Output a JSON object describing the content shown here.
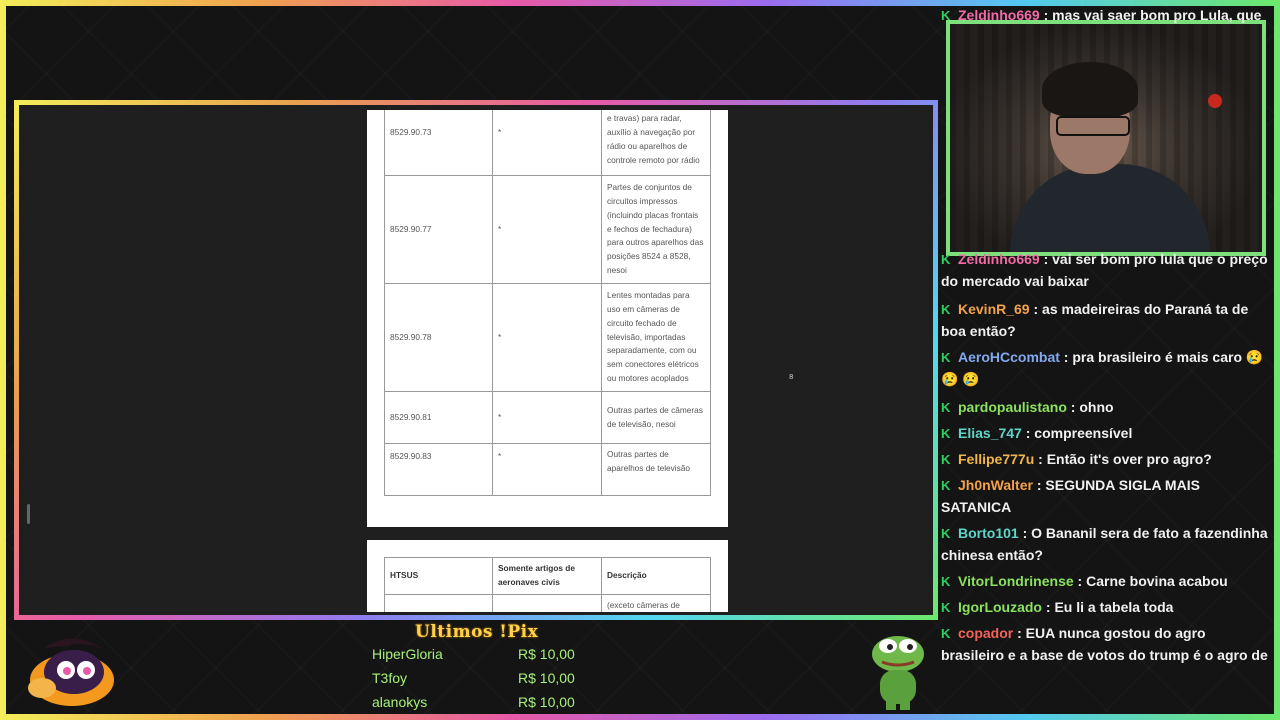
{
  "document": {
    "rows_page1": [
      {
        "code": "8529.90.73",
        "mark": "*",
        "desc": "(incluindo placas frontais e travas) para radar, auxílio à navegação por rádio ou aparelhos de controle remoto por rádio"
      },
      {
        "code": "8529.90.77",
        "mark": "*",
        "desc": "Partes de conjuntos de circuitos impressos (incluindo placas frontais e fechos de fechadura) para outros aparelhos das posições 8524 a 8528, nesoi"
      },
      {
        "code": "8529.90.78",
        "mark": "*",
        "desc": "Lentes montadas para uso em câmeras de circuito fechado de televisão, importadas separadamente, com ou sem conectores elétricos ou motores acoplados"
      },
      {
        "code": "8529.90.81",
        "mark": "*",
        "desc": "Outras partes de câmeras de televisão, nesoi"
      },
      {
        "code": "8529.90.83",
        "mark": "*",
        "desc": "Outras partes de aparelhos de televisão"
      }
    ],
    "header_page2": {
      "col1": "HTSUS",
      "col2": "Somente artigos de aeronaves civis",
      "col3": "Descrição"
    },
    "row_page2": {
      "code": "",
      "mark": "",
      "desc": "(exceto câmeras de televisão), nesoi"
    },
    "cursor_glyph": "8"
  },
  "chat": {
    "messages": [
      {
        "user": "Zeldinho669",
        "color": "#f26ba6",
        "text": ": mas vai saer bom pro Lula, que"
      },
      {
        "user": "Zeldinho669",
        "color": "#f26ba6",
        "text": ": vai ser bom pro lula que o preço do mercado vai baixar"
      },
      {
        "user": "KevinR_69",
        "color": "#f3a24a",
        "text": ": as madeireiras do Paraná ta de boa então?"
      },
      {
        "user": "AeroHCcombat",
        "color": "#82a8f0",
        "text": ": pra brasileiro é mais caro 😢 😢 😢"
      },
      {
        "user": "pardopaulistano",
        "color": "#8ae25f",
        "text": ": ohno"
      },
      {
        "user": "Elias_747",
        "color": "#5fd5c9",
        "text": ": compreensível"
      },
      {
        "user": "Fellipe777u",
        "color": "#f3b54a",
        "text": ": Então it's over pro agro?"
      },
      {
        "user": "Jh0nWalter",
        "color": "#f3a24a",
        "text": ": SEGUNDA SIGLA MAIS SATANICA"
      },
      {
        "user": "Borto101",
        "color": "#5fd5c9",
        "text": ": O Bananil sera de fato a fazendinha chinesa então?"
      },
      {
        "user": "VitorLondrinense",
        "color": "#8ae25f",
        "text": ": Carne bovina acabou"
      },
      {
        "user": "IgorLouzado",
        "color": "#8ae25f",
        "text": ": Eu li a tabela toda"
      },
      {
        "user": "copador",
        "color": "#f2645a",
        "text": ": EUA nunca gostou do agro brasileiro e a base de votos do trump é o agro de lá"
      }
    ]
  },
  "pix": {
    "title": "Ultimos !Pix",
    "entries": [
      {
        "name": "HiperGloria",
        "value": "R$ 10,00"
      },
      {
        "name": "T3foy",
        "value": "R$ 10,00"
      },
      {
        "name": "alanokys",
        "value": "R$ 10,00"
      }
    ]
  },
  "icons": {
    "badge": "subscriber-badge-icon",
    "mascot": "mascot-character-icon",
    "pepe": "pepe-frog-icon"
  }
}
